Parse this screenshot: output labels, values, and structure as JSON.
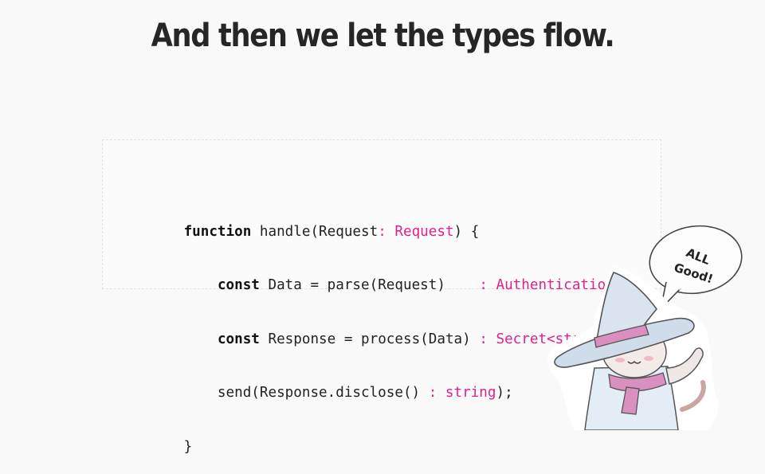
{
  "title": "And then we let the types flow.",
  "code_lines": [
    [
      {
        "t": "function",
        "c": "kw"
      },
      {
        "t": " handle(Request",
        "c": ""
      },
      {
        "t": ": Request",
        "c": "ty"
      },
      {
        "t": ") {",
        "c": ""
      }
    ],
    [
      {
        "t": "    ",
        "c": ""
      },
      {
        "t": "const",
        "c": "kw"
      },
      {
        "t": " Data = parse(Request)    ",
        "c": ""
      },
      {
        "t": ": Authentication",
        "c": "ty"
      }
    ],
    [
      {
        "t": "    ",
        "c": ""
      },
      {
        "t": "const",
        "c": "kw"
      },
      {
        "t": " Response = process(Data) ",
        "c": ""
      },
      {
        "t": ": Secret<string>",
        "c": "ty"
      }
    ],
    [
      {
        "t": "    send(Response.disclose() ",
        "c": ""
      },
      {
        "t": ": string",
        "c": "ty"
      },
      {
        "t": ");",
        "c": ""
      }
    ],
    [
      {
        "t": "}",
        "c": ""
      }
    ]
  ],
  "speech_bubble": {
    "line1": "ALL",
    "line2": "Good!"
  },
  "colors": {
    "type_annotation": "#e0218a",
    "text": "#222222",
    "background": "#f9f9f9"
  },
  "illustration": "wizard-cat-mascot"
}
